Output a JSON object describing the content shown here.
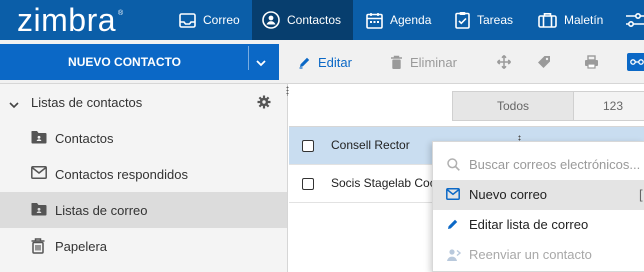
{
  "app": {
    "logo": "zimbra",
    "logo_mark": "®"
  },
  "nav": {
    "tabs": [
      {
        "label": "Correo",
        "icon": "mail-icon",
        "active": false
      },
      {
        "label": "Contactos",
        "icon": "contacts-icon",
        "active": true
      },
      {
        "label": "Agenda",
        "icon": "calendar-icon",
        "active": false
      },
      {
        "label": "Tareas",
        "icon": "tasks-icon",
        "active": false
      },
      {
        "label": "Maletín",
        "icon": "briefcase-icon",
        "active": false
      }
    ]
  },
  "toolbar": {
    "new_contact": "NUEVO CONTACTO",
    "edit": "Editar",
    "delete": "Eliminar"
  },
  "sidebar": {
    "header": "Listas de contactos",
    "items": [
      {
        "label": "Contactos",
        "icon": "contacts-folder-icon",
        "selected": false
      },
      {
        "label": "Contactos respondidos",
        "icon": "envelope-icon",
        "selected": false
      },
      {
        "label": "Listas de correo",
        "icon": "contacts-folder-icon",
        "selected": true
      },
      {
        "label": "Papelera",
        "icon": "trash-icon",
        "selected": false
      }
    ]
  },
  "list": {
    "filters": [
      {
        "label": "Todos",
        "selected": true
      },
      {
        "label": "123",
        "selected": false
      }
    ],
    "rows": [
      {
        "name": "Consell Rector",
        "selected": true
      },
      {
        "name": "Socis Stagelab Coc",
        "selected": false
      }
    ]
  },
  "context_menu": {
    "search_placeholder": "Buscar correos electrónicos...",
    "items": [
      {
        "label": "Nuevo correo",
        "icon": "envelope-icon",
        "shortcut": "[",
        "highlighted": true,
        "disabled": false
      },
      {
        "label": "Editar lista de correo",
        "icon": "pencil-icon",
        "highlighted": false,
        "disabled": false
      },
      {
        "label": "Reenviar un contacto",
        "icon": "forward-contact-icon",
        "highlighted": false,
        "disabled": true
      }
    ]
  },
  "colors": {
    "topbar": "#0b5ea8",
    "active_tab": "#073e6e",
    "primary_button": "#0b68c6",
    "selected_row": "#c9ddf0",
    "selected_sidebar": "#dcdcdc"
  }
}
